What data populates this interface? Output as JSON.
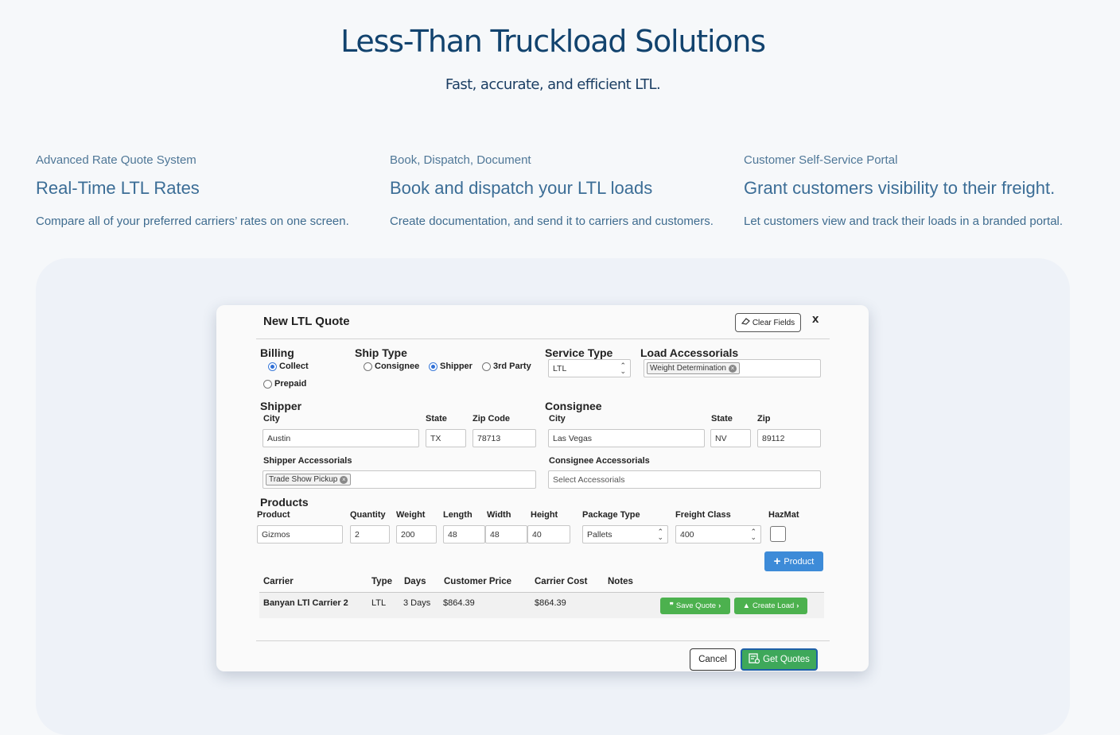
{
  "hero": {
    "title": "Less-Than Truckload Solutions",
    "subtitle": "Fast, accurate, and efficient LTL."
  },
  "features": [
    {
      "kicker": "Advanced Rate Quote System",
      "title": "Real-Time LTL Rates",
      "desc": "Compare all of your preferred carriers’ rates on one screen."
    },
    {
      "kicker": "Book, Dispatch, Document",
      "title": "Book and dispatch your LTL loads",
      "desc": "Create documentation, and send it to carriers and customers."
    },
    {
      "kicker": "Customer Self-Service Portal",
      "title": "Grant customers visibility to their freight.",
      "desc": "Let customers view and track their loads in a branded portal."
    }
  ],
  "modal": {
    "title": "New LTL Quote",
    "clear_label": "Clear Fields",
    "close_label": "x",
    "billing": {
      "label": "Billing",
      "options": [
        "Collect",
        "Prepaid"
      ],
      "selected": "Collect"
    },
    "ship_type": {
      "label": "Ship Type",
      "options": [
        "Consignee",
        "Shipper",
        "3rd Party"
      ],
      "selected": "Shipper"
    },
    "service_type": {
      "label": "Service Type",
      "value": "LTL"
    },
    "load_accessorials": {
      "label": "Load Accessorials",
      "tags": [
        "Weight Determination"
      ]
    },
    "shipper": {
      "label": "Shipper",
      "city_label": "City",
      "city": "Austin",
      "state_label": "State",
      "state": "TX",
      "zip_label": "Zip Code",
      "zip": "78713",
      "accessorials_label": "Shipper Accessorials",
      "accessorials": [
        "Trade Show Pickup"
      ]
    },
    "consignee": {
      "label": "Consignee",
      "city_label": "City",
      "city": "Las Vegas",
      "state_label": "State",
      "state": "NV",
      "zip_label": "Zip",
      "zip": "89112",
      "accessorials_label": "Consignee Accessorials",
      "accessorials_placeholder": "Select Accessorials"
    },
    "products": {
      "label": "Products",
      "headers": {
        "product": "Product",
        "quantity": "Quantity",
        "weight": "Weight",
        "length": "Length",
        "width": "Width",
        "height": "Height",
        "package": "Package Type",
        "freight_class": "Freight Class",
        "hazmat": "HazMat"
      },
      "row": {
        "product": "Gizmos",
        "quantity": "2",
        "weight": "200",
        "length": "48",
        "width": "48",
        "height": "40",
        "package": "Pallets",
        "freight_class": "400",
        "hazmat": false
      },
      "add_label": "Product"
    },
    "carriers": {
      "headers": {
        "carrier": "Carrier",
        "type": "Type",
        "days": "Days",
        "customer_price": "Customer Price",
        "carrier_cost": "Carrier Cost",
        "notes": "Notes"
      },
      "rows": [
        {
          "carrier": "Banyan LTl Carrier 2",
          "type": "LTL",
          "days": "3 Days",
          "customer_price": "$864.39",
          "carrier_cost": "$864.39",
          "notes": ""
        }
      ],
      "save_label": "Save Quote",
      "create_label": "Create Load"
    },
    "footer": {
      "cancel_label": "Cancel",
      "get_label": "Get Quotes"
    }
  },
  "colors": {
    "heading": "#12436e",
    "feature_text": "#3f6c8f",
    "panel_bg": "#eef2f8",
    "primary_blue": "#3d8bd8",
    "action_green": "#4cb14e"
  }
}
